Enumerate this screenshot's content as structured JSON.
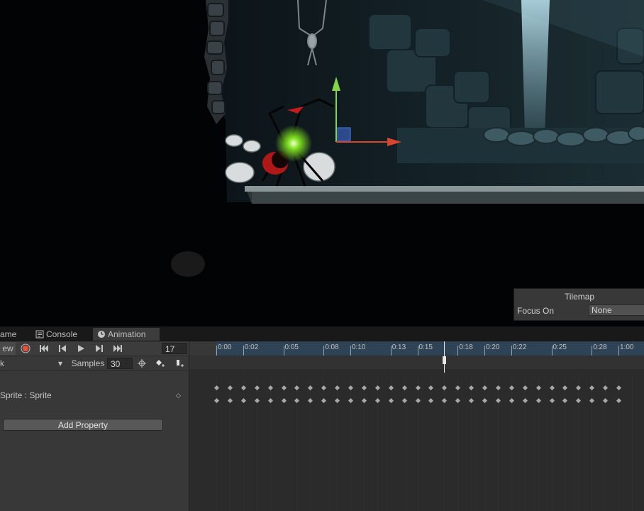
{
  "scene_overlay": {
    "tilemap_title": "Tilemap",
    "focus_on_label": "Focus On",
    "focus_on_value": "None"
  },
  "tabs": [
    {
      "label": "ame",
      "icon": "game-icon"
    },
    {
      "label": "Console",
      "icon": "console-icon"
    },
    {
      "label": "Animation",
      "icon": "animation-clock-icon",
      "active": true
    }
  ],
  "animation": {
    "preview_label": "ew",
    "current_frame": "17",
    "clip_name": "k",
    "samples_label": "Samples",
    "samples_value": "30",
    "property_label": "Sprite : Sprite",
    "add_property_label": "Add Property",
    "ruler_ticks": [
      "0:00",
      "0:02",
      "0:05",
      "0:08",
      "0:10",
      "0:13",
      "0:15",
      "0:18",
      "0:20",
      "0:22",
      "0:25",
      "0:28",
      "1:00"
    ],
    "playhead_frame": 17,
    "keyframe_count": 31
  },
  "colors": {
    "record": "#e0523a",
    "ruler_strip": "#2f4356",
    "panel_bg": "#383838"
  }
}
